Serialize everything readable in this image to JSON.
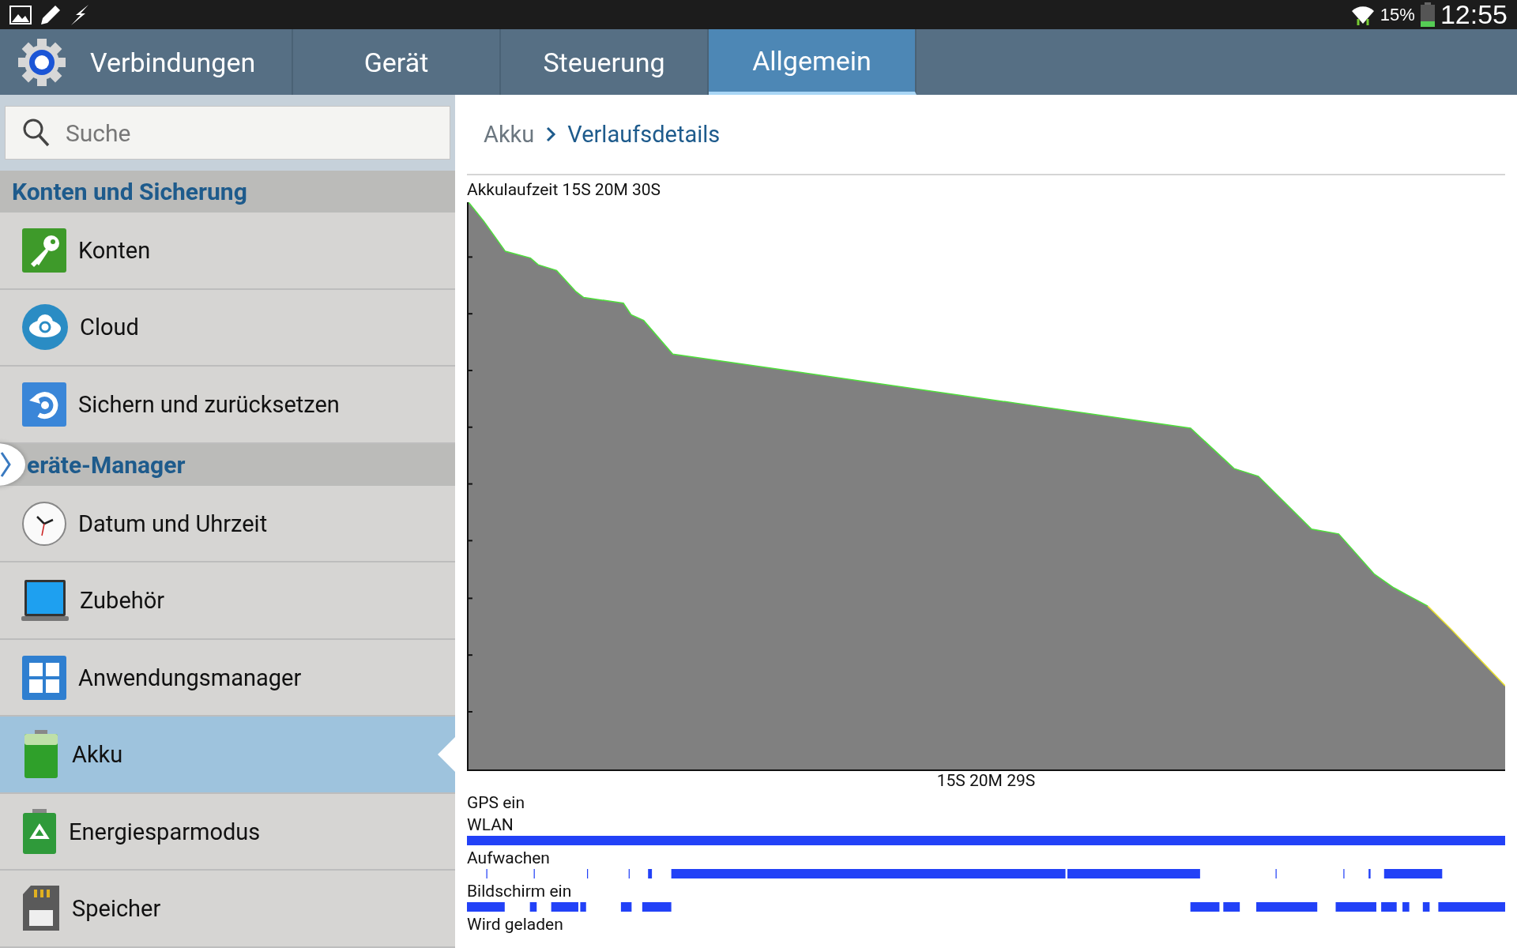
{
  "status_bar": {
    "battery_percent": "15%",
    "time": "12:55"
  },
  "tabs": [
    {
      "label": "Verbindungen",
      "selected": false
    },
    {
      "label": "Gerät",
      "selected": false
    },
    {
      "label": "Steuerung",
      "selected": false
    },
    {
      "label": "Allgemein",
      "selected": true
    }
  ],
  "sidebar": {
    "search": {
      "placeholder": "Suche"
    },
    "sections": [
      {
        "title": "Konten und Sicherung",
        "items": [
          {
            "label": "Konten",
            "kind": "key",
            "selected": false
          },
          {
            "label": "Cloud",
            "kind": "cloud",
            "selected": false
          },
          {
            "label": "Sichern und zurücksetzen",
            "kind": "backup",
            "selected": false
          }
        ]
      },
      {
        "title": "eräte-Manager",
        "items": [
          {
            "label": "Datum und Uhrzeit",
            "kind": "clock",
            "selected": false
          },
          {
            "label": "Zubehör",
            "kind": "accessory",
            "selected": false
          },
          {
            "label": "Anwendungsmanager",
            "kind": "apps",
            "selected": false
          },
          {
            "label": "Akku",
            "kind": "battery",
            "selected": true
          },
          {
            "label": "Energiesparmodus",
            "kind": "recycle",
            "selected": false
          },
          {
            "label": "Speicher",
            "kind": "storage",
            "selected": false
          }
        ]
      }
    ]
  },
  "breadcrumb": [
    {
      "label": "Akku",
      "selected": false
    },
    {
      "label": "Verlaufsdetails",
      "selected": true
    }
  ],
  "battery_chart": {
    "title": "Akkulaufzeit 15S 20M 30S",
    "xlabel": "15S 20M 29S"
  },
  "activities": [
    {
      "label": "GPS ein"
    },
    {
      "label": "WLAN"
    },
    {
      "label": "Aufwachen"
    },
    {
      "label": "Bildschirm ein"
    },
    {
      "label": "Wird geladen"
    }
  ]
}
